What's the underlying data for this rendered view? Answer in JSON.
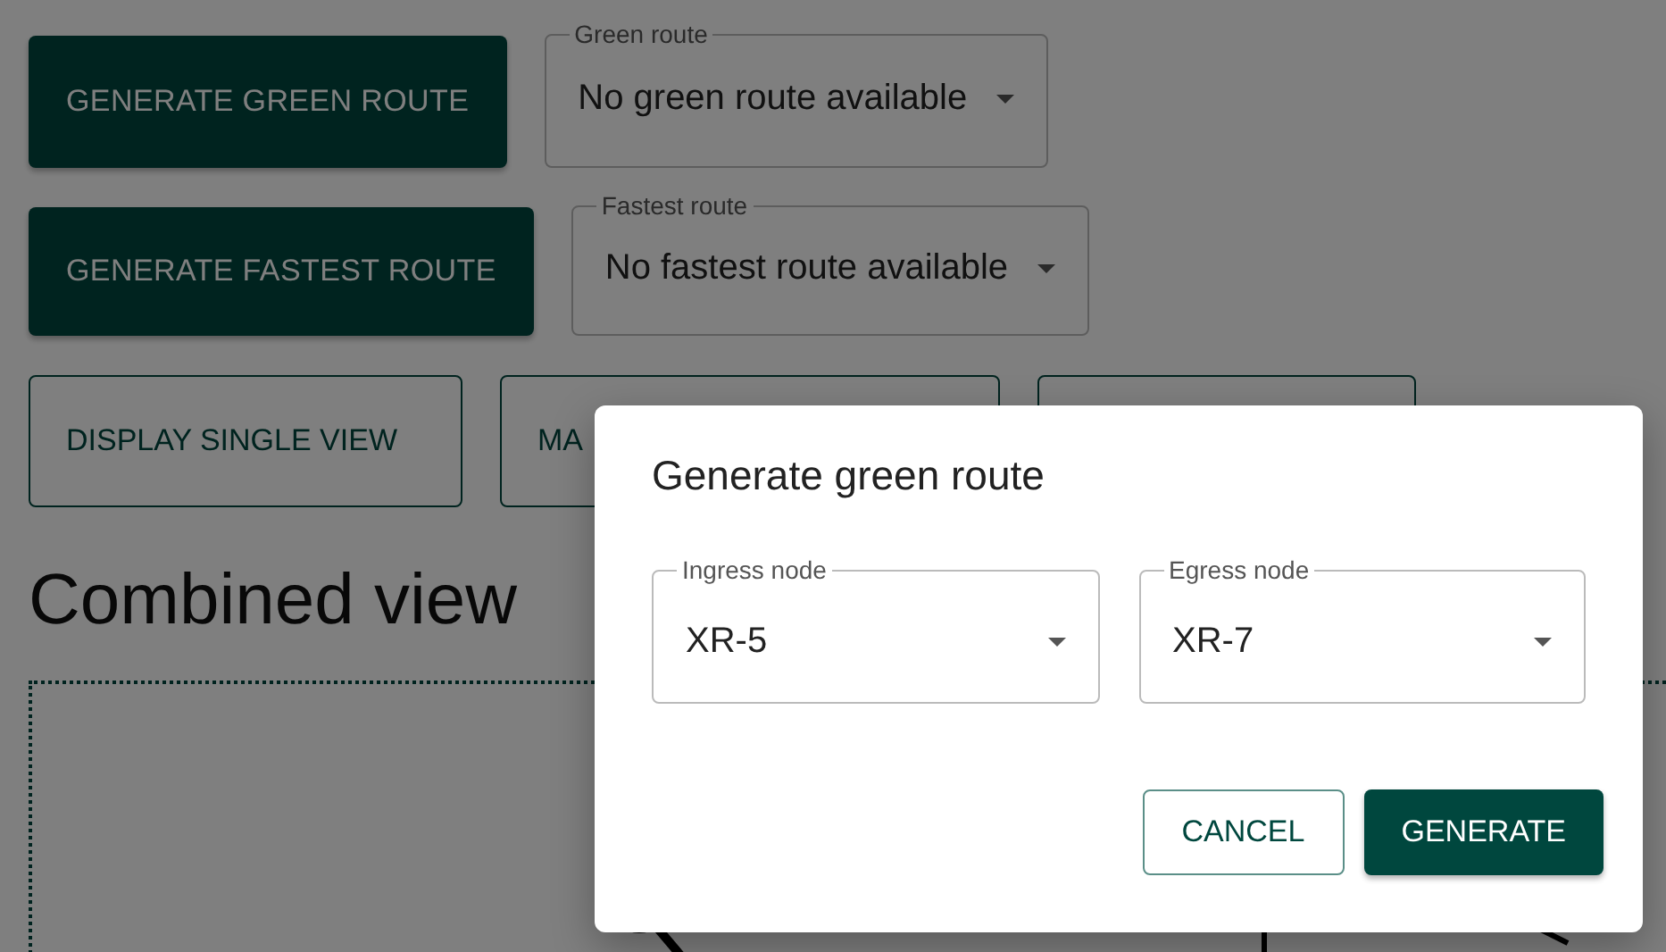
{
  "route_controls": [
    {
      "button": "GENERATE GREEN ROUTE",
      "select": {
        "label": "Green route",
        "value": "No green route available"
      }
    },
    {
      "button": "GENERATE FASTEST ROUTE",
      "select": {
        "label": "Fastest route",
        "value": "No fastest route available"
      }
    }
  ],
  "view_buttons": [
    {
      "label": "DISPLAY SINGLE VIEW"
    },
    {
      "label": "MA"
    }
  ],
  "heading": "Combined view",
  "dialog": {
    "title": "Generate green route",
    "fields": [
      {
        "label": "Ingress node",
        "value": "XR-5"
      },
      {
        "label": "Egress node",
        "value": "XR-7"
      }
    ],
    "actions": [
      {
        "label": "CANCEL",
        "kind": "outlined"
      },
      {
        "label": "GENERATE",
        "kind": "filled"
      }
    ]
  }
}
